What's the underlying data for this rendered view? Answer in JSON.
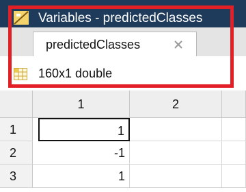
{
  "window": {
    "title": "Variables - predictedClasses",
    "icon": "variables-icon"
  },
  "tab": {
    "label": "predictedClasses",
    "close_icon": "close-icon"
  },
  "info": {
    "icon": "grid-icon",
    "text": "160x1 double"
  },
  "grid": {
    "columns": [
      "",
      "1",
      "2"
    ],
    "rows": [
      {
        "label": "1",
        "values": [
          "1",
          ""
        ]
      },
      {
        "label": "2",
        "values": [
          "-1",
          ""
        ]
      },
      {
        "label": "3",
        "values": [
          "1",
          ""
        ]
      }
    ]
  },
  "colors": {
    "titlebar": "#1f3b5c",
    "highlight": "#e21f26"
  }
}
